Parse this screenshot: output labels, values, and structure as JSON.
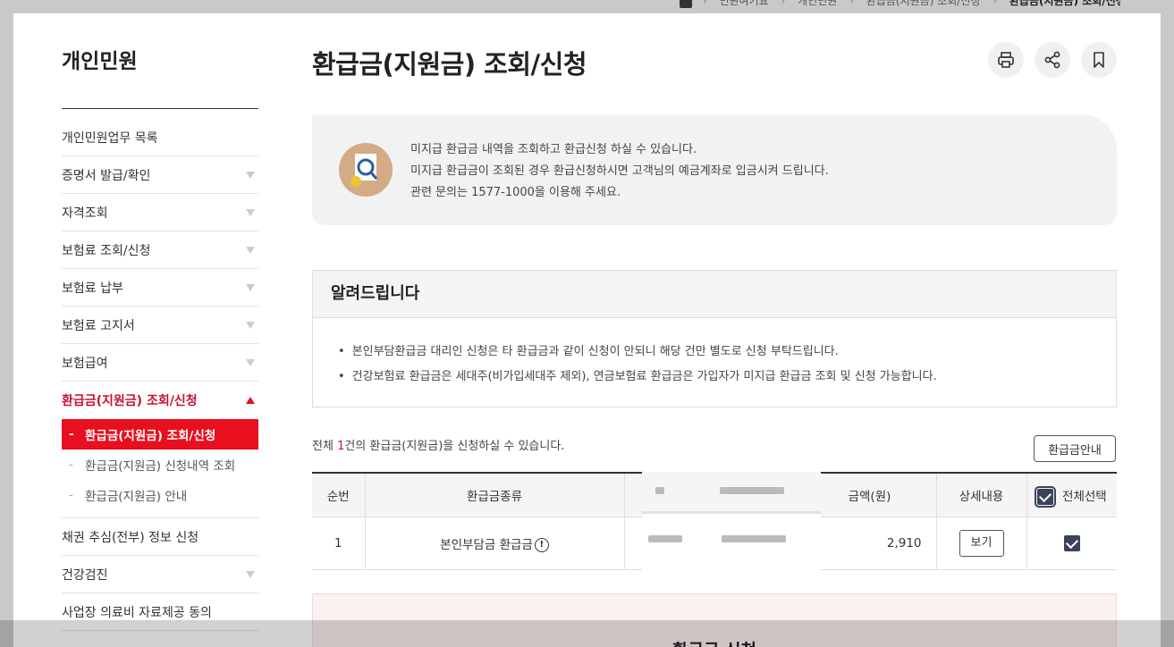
{
  "breadcrumb": [
    "민원여기요",
    "개인민원",
    "환급금(지원금) 조회/신청",
    "환급금(지원금) 조회/신청"
  ],
  "sidebar": {
    "title": "개인민원",
    "items": [
      {
        "label": "개인민원업무 목록"
      },
      {
        "label": "증명서 발급/확인"
      },
      {
        "label": "자격조회"
      },
      {
        "label": "보험료 조회/신청"
      },
      {
        "label": "보험료 납부"
      },
      {
        "label": "보험료 고지서"
      },
      {
        "label": "보험급여"
      },
      {
        "label": "환급금(지원금) 조회/신청"
      },
      {
        "label": "채권 추심(전부) 정보 신청"
      },
      {
        "label": "건강검진"
      },
      {
        "label": "사업장 의료비 자료제공 동의"
      }
    ],
    "subitems": [
      {
        "label": "환급금(지원금) 조회/신청"
      },
      {
        "label": "환급금(지원금) 신청내역 조회"
      },
      {
        "label": "환급금(지원금) 안내"
      }
    ]
  },
  "main": {
    "title": "환급금(지원금) 조회/신청",
    "tools": [
      "print-icon",
      "share-icon",
      "bookmark-icon"
    ],
    "info_lines": [
      "미지급 환급금 내역을 조회하고 환급신청 하실 수 있습니다.",
      "미지급 환급금이 조회된 경우 환급신청하시면 고객님의 예금계좌로 입금시켜 드립니다.",
      "관련 문의는 1577-1000을 이용해 주세요."
    ],
    "notice_title": "알려드립니다",
    "notice_items": [
      "본인부담환급금 대리인 신청은 타 환급금과 같이 신청이 안되니 해당 건만 별도로 신청 부탁드립니다.",
      "건강보험료 환급금은 세대주(비가입세대주 제외), 연금보험료 환급금은 가입자가 미지급 환급금 조회 및 신청 가능합니다."
    ],
    "count_prefix": "전체 ",
    "count_value": "1",
    "count_suffix": "건의 환급금(지원금)을 신청하실 수 있습니다.",
    "guide_button": "환급금안내",
    "table": {
      "headers": [
        "순번",
        "환급금종류",
        "금액(원)",
        "상세내용",
        "전체선택"
      ],
      "rows": [
        {
          "no": "1",
          "type": "본인부담금 환급금",
          "amount": "2,910",
          "detail": "보기"
        }
      ]
    },
    "apply_title": "환급금 신청"
  }
}
